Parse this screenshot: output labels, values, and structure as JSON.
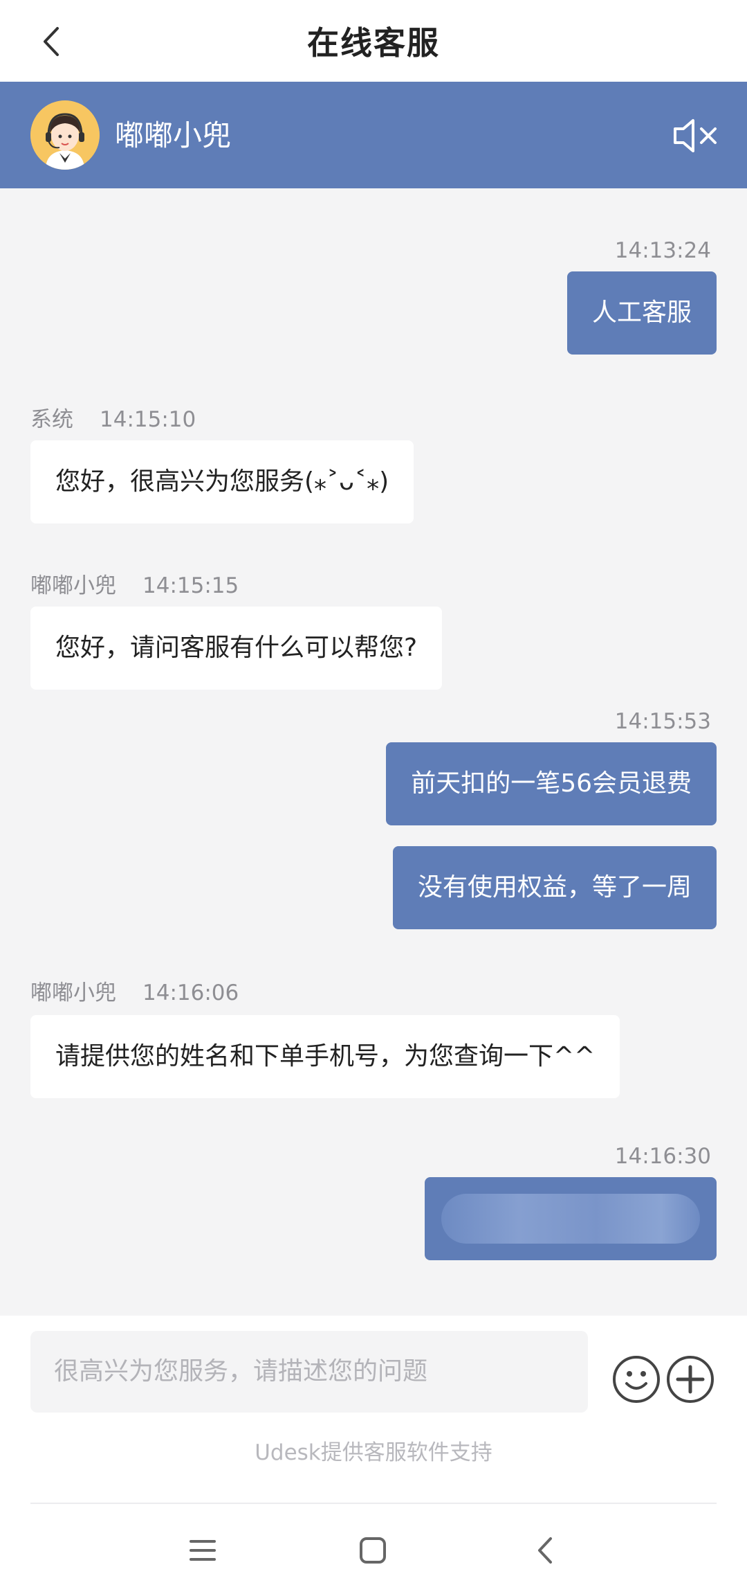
{
  "header": {
    "title": "在线客服",
    "back_icon": "chevron-left-icon"
  },
  "agent": {
    "name": "嘟嘟小兜",
    "avatar": "customer-service-avatar",
    "mute_icon": "speaker-muted-icon",
    "bar_color": "#5f7db7"
  },
  "messages": [
    {
      "side": "out",
      "time": "14:13:24",
      "text": "人工客服"
    },
    {
      "side": "in",
      "sender": "系统",
      "time": "14:15:10",
      "text": "您好，很高兴为您服务(⁎˃ᴗ˂⁎)"
    },
    {
      "side": "in",
      "sender": "嘟嘟小兜",
      "time": "14:15:15",
      "text": "您好，请问客服有什么可以帮您?"
    },
    {
      "side": "out",
      "time": "14:15:53",
      "text": "前天扣的一笔56会员退费"
    },
    {
      "side": "out",
      "text": "没有使用权益，等了一周"
    },
    {
      "side": "in",
      "sender": "嘟嘟小兜",
      "time": "14:16:06",
      "text": "请提供您的姓名和下单手机号，为您查询一下^^"
    },
    {
      "side": "out",
      "time": "14:16:30",
      "text": "",
      "redacted": true
    }
  ],
  "composer": {
    "placeholder": "很高兴为您服务，请描述您的问题",
    "emoji_icon": "smiley-icon",
    "plus_icon": "plus-circle-icon",
    "powered_by": "Udesk提供客服软件支持"
  },
  "system_nav": {
    "menu_icon": "menu-lines-icon",
    "home_icon": "square-home-icon",
    "back_icon": "back-triangle-icon"
  }
}
